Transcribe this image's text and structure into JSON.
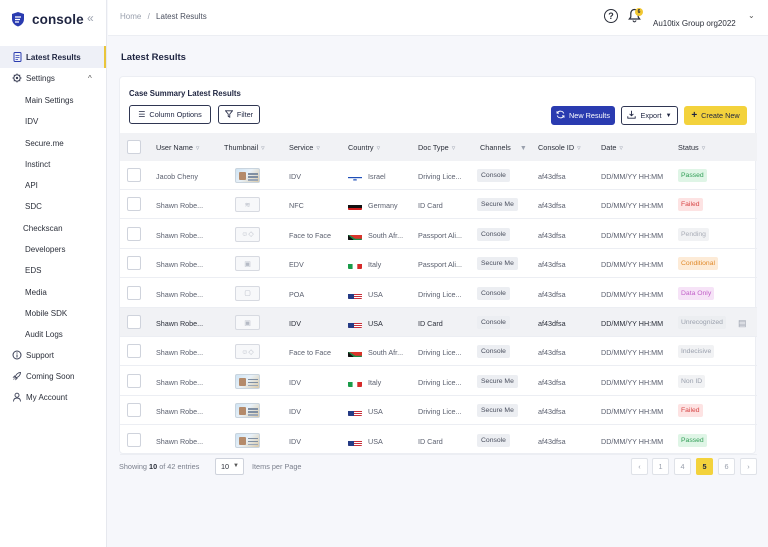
{
  "app": {
    "brand": "console"
  },
  "sidebar": {
    "latest_results": "Latest Results",
    "settings": "Settings",
    "settings_items": [
      "Main Settings",
      "IDV",
      "Secure.me",
      "Instinct",
      "API",
      "SDC"
    ],
    "other_items": [
      "Checkscan",
      "Developers",
      "EDS",
      "Media",
      "Mobile SDK",
      "Audit Logs"
    ],
    "support": "Support",
    "coming_soon": "Coming Soon",
    "my_account": "My Account"
  },
  "header": {
    "crumb_home": "Home",
    "crumb_sep": "/",
    "crumb_current": "Latest Results",
    "help": "?",
    "notif_count": "6",
    "org": "Au10tix Group org2022"
  },
  "page": {
    "title": "Latest Results"
  },
  "card": {
    "title": "Case Summary Latest Results",
    "column_options": "Column Options",
    "filter": "Filter",
    "new_results": "New Results",
    "export": "Export",
    "create_new": "Create New"
  },
  "table": {
    "columns": [
      "User Name",
      "Thumbnail",
      "Service",
      "Country",
      "Doc Type",
      "Channels",
      "Console ID",
      "Date",
      "Status"
    ],
    "rows": [
      {
        "user": "Jacob Cheny",
        "thumb": "doc",
        "service": "IDV",
        "flag": "il",
        "country": "Israel",
        "doc": "Driving Lice...",
        "channel": "Console",
        "id": "af43dfsa",
        "date": "DD/MM/YY HH:MM",
        "status": "Passed"
      },
      {
        "user": "Shawn Robe...",
        "thumb": "nfc",
        "service": "NFC",
        "flag": "de",
        "country": "Germany",
        "doc": "ID Card",
        "channel": "Secure Me",
        "id": "af43dfsa",
        "date": "DD/MM/YY HH:MM",
        "status": "Failed"
      },
      {
        "user": "Shawn Robe...",
        "thumb": "face",
        "service": "Face to Face",
        "flag": "za",
        "country": "South Afr...",
        "doc": "Passport Ali...",
        "channel": "Console",
        "id": "af43dfsa",
        "date": "DD/MM/YY HH:MM",
        "status": "Pending"
      },
      {
        "user": "Shawn Robe...",
        "thumb": "card",
        "service": "EDV",
        "flag": "it",
        "country": "Italy",
        "doc": "Passport Ali...",
        "channel": "Secure Me",
        "id": "af43dfsa",
        "date": "DD/MM/YY HH:MM",
        "status": "Conditional"
      },
      {
        "user": "Shawn Robe...",
        "thumb": "poa",
        "service": "POA",
        "flag": "us",
        "country": "USA",
        "doc": "Driving Lice...",
        "channel": "Console",
        "id": "af43dfsa",
        "date": "DD/MM/YY HH:MM",
        "status": "Data Only"
      },
      {
        "user": "Shawn Robe...",
        "thumb": "card",
        "service": "IDV",
        "flag": "us",
        "country": "USA",
        "doc": "ID Card",
        "channel": "Console",
        "id": "af43dfsa",
        "date": "DD/MM/YY HH:MM",
        "status": "Unrecognized"
      },
      {
        "user": "Shawn Robe...",
        "thumb": "face",
        "service": "Face to Face",
        "flag": "za",
        "country": "South Afr...",
        "doc": "Driving Lice...",
        "channel": "Console",
        "id": "af43dfsa",
        "date": "DD/MM/YY HH:MM",
        "status": "Indecisive"
      },
      {
        "user": "Shawn Robe...",
        "thumb": "doc",
        "service": "IDV",
        "flag": "it",
        "country": "Italy",
        "doc": "Driving Lice...",
        "channel": "Secure Me",
        "id": "af43dfsa",
        "date": "DD/MM/YY HH:MM",
        "status": "Non ID"
      },
      {
        "user": "Shawn Robe...",
        "thumb": "doc",
        "service": "IDV",
        "flag": "us",
        "country": "USA",
        "doc": "Driving Lice...",
        "channel": "Secure Me",
        "id": "af43dfsa",
        "date": "DD/MM/YY HH:MM",
        "status": "Failed"
      },
      {
        "user": "Shawn Robe...",
        "thumb": "doc",
        "service": "IDV",
        "flag": "us",
        "country": "USA",
        "doc": "ID Card",
        "channel": "Console",
        "id": "af43dfsa",
        "date": "DD/MM/YY HH:MM",
        "status": "Passed"
      }
    ]
  },
  "status_colors": {
    "Passed": {
      "bg": "#dff5e6",
      "fg": "#2f9d55"
    },
    "Failed": {
      "bg": "#fde3e3",
      "fg": "#d64545"
    },
    "Pending": {
      "bg": "#f1f2f4",
      "fg": "#a8acb6"
    },
    "Conditional": {
      "bg": "#fdebd7",
      "fg": "#e08a2c"
    },
    "Data Only": {
      "bg": "#f6e3f7",
      "fg": "#c15fc8"
    },
    "Unrecognized": {
      "bg": "#eceef1",
      "fg": "#9aa0ad"
    },
    "Indecisive": {
      "bg": "#f1f2f4",
      "fg": "#9aa0ad"
    },
    "Non ID": {
      "bg": "#f1f2f4",
      "fg": "#9aa0ad"
    }
  },
  "footer": {
    "showing_prefix": "Showing",
    "showing_count": "10",
    "showing_suffix": "of 42 entries",
    "per_page": "10",
    "items_per_page": "Items per Page",
    "pages": [
      "1",
      "4",
      "5",
      "6"
    ],
    "current_page": "5"
  },
  "colors": {
    "accent": "#f3d23c",
    "primary": "#2a3bb0"
  }
}
